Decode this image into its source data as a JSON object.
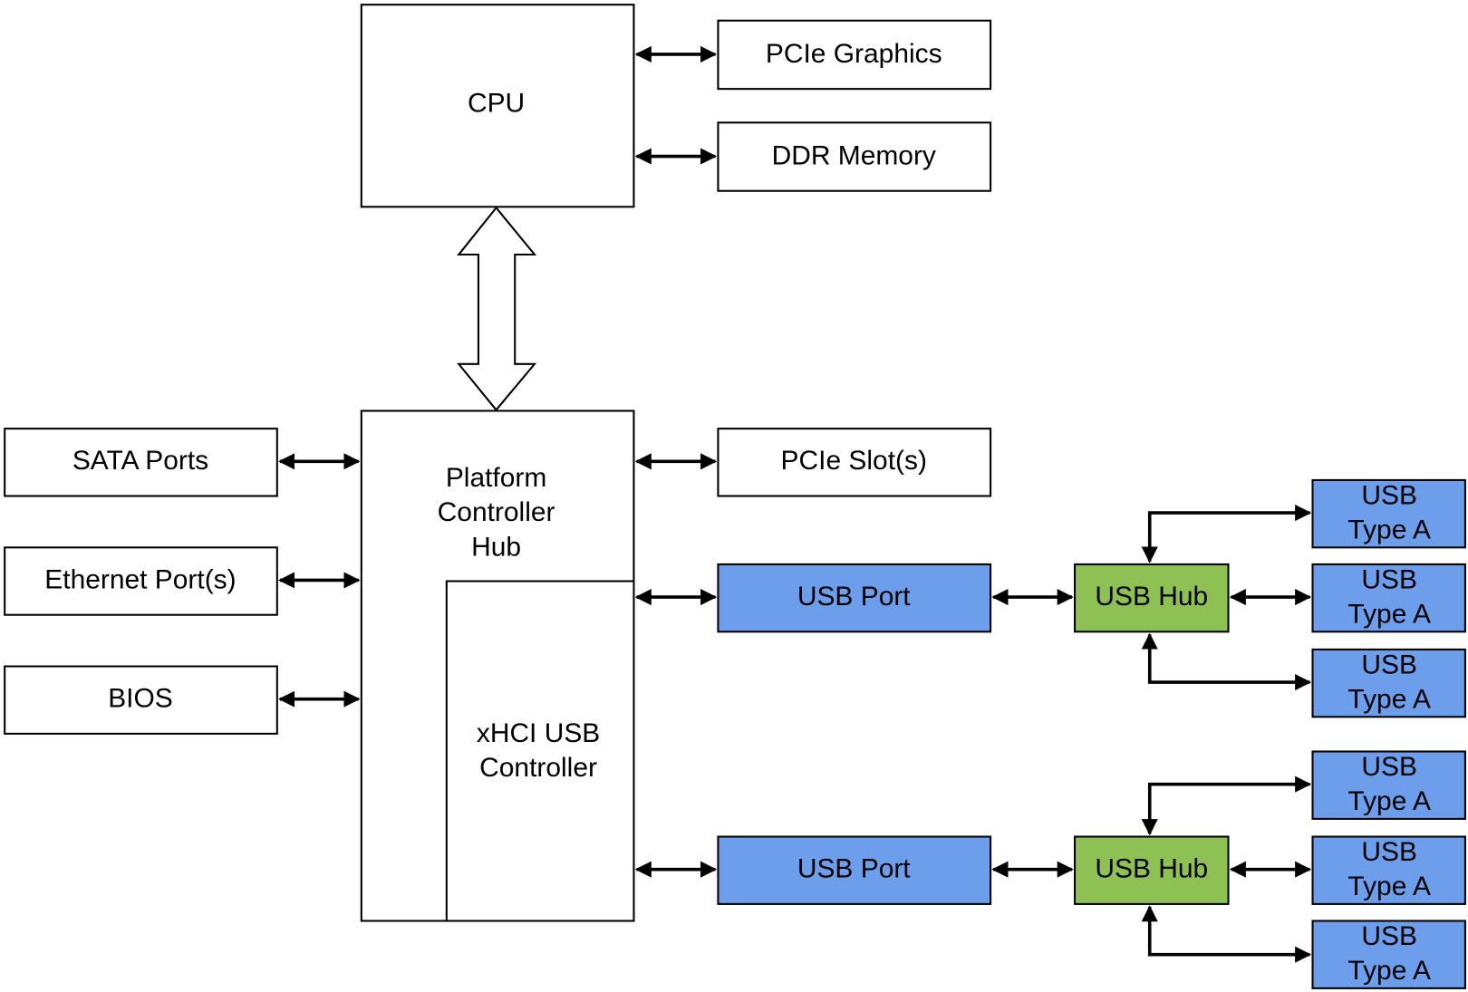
{
  "colors": {
    "plain": "#ffffff",
    "usb_port": "#6d9eeb",
    "usb_hub": "#8dc153",
    "usb_type_a": "#6d9eeb",
    "line": "#000000"
  },
  "nodes": {
    "cpu": "CPU",
    "pcie_graphics": "PCIe Graphics",
    "ddr_memory": "DDR Memory",
    "pch": [
      "Platform",
      "Controller",
      "Hub"
    ],
    "xhci": [
      "xHCI USB",
      "Controller"
    ],
    "sata": "SATA Ports",
    "ethernet": "Ethernet Port(s)",
    "bios": "BIOS",
    "pcie_slots": "PCIe Slot(s)",
    "usb_port_1": "USB Port",
    "usb_port_2": "USB Port",
    "usb_hub_1": "USB Hub",
    "usb_hub_2": "USB Hub",
    "usb_type_a": [
      [
        "USB",
        "Type A"
      ],
      [
        "USB",
        "Type A"
      ],
      [
        "USB",
        "Type A"
      ],
      [
        "USB",
        "Type A"
      ],
      [
        "USB",
        "Type A"
      ],
      [
        "USB",
        "Type A"
      ]
    ]
  }
}
